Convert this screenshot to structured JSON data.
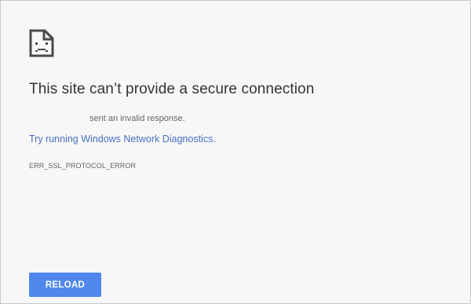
{
  "error_page": {
    "icon": "sad-page-icon",
    "title": "This site can’t provide a secure connection",
    "subtitle": "sent an invalid response.",
    "diagnostics_link": "Try running Windows Network Diagnostics.",
    "error_code": "ERR_SSL_PROTOCOL_ERROR",
    "reload_label": "RELOAD"
  },
  "colors": {
    "background": "#f7f7f7",
    "link": "#4a6fc1",
    "button": "#4f87ec",
    "title_text": "#333333",
    "secondary_text": "#646464"
  }
}
